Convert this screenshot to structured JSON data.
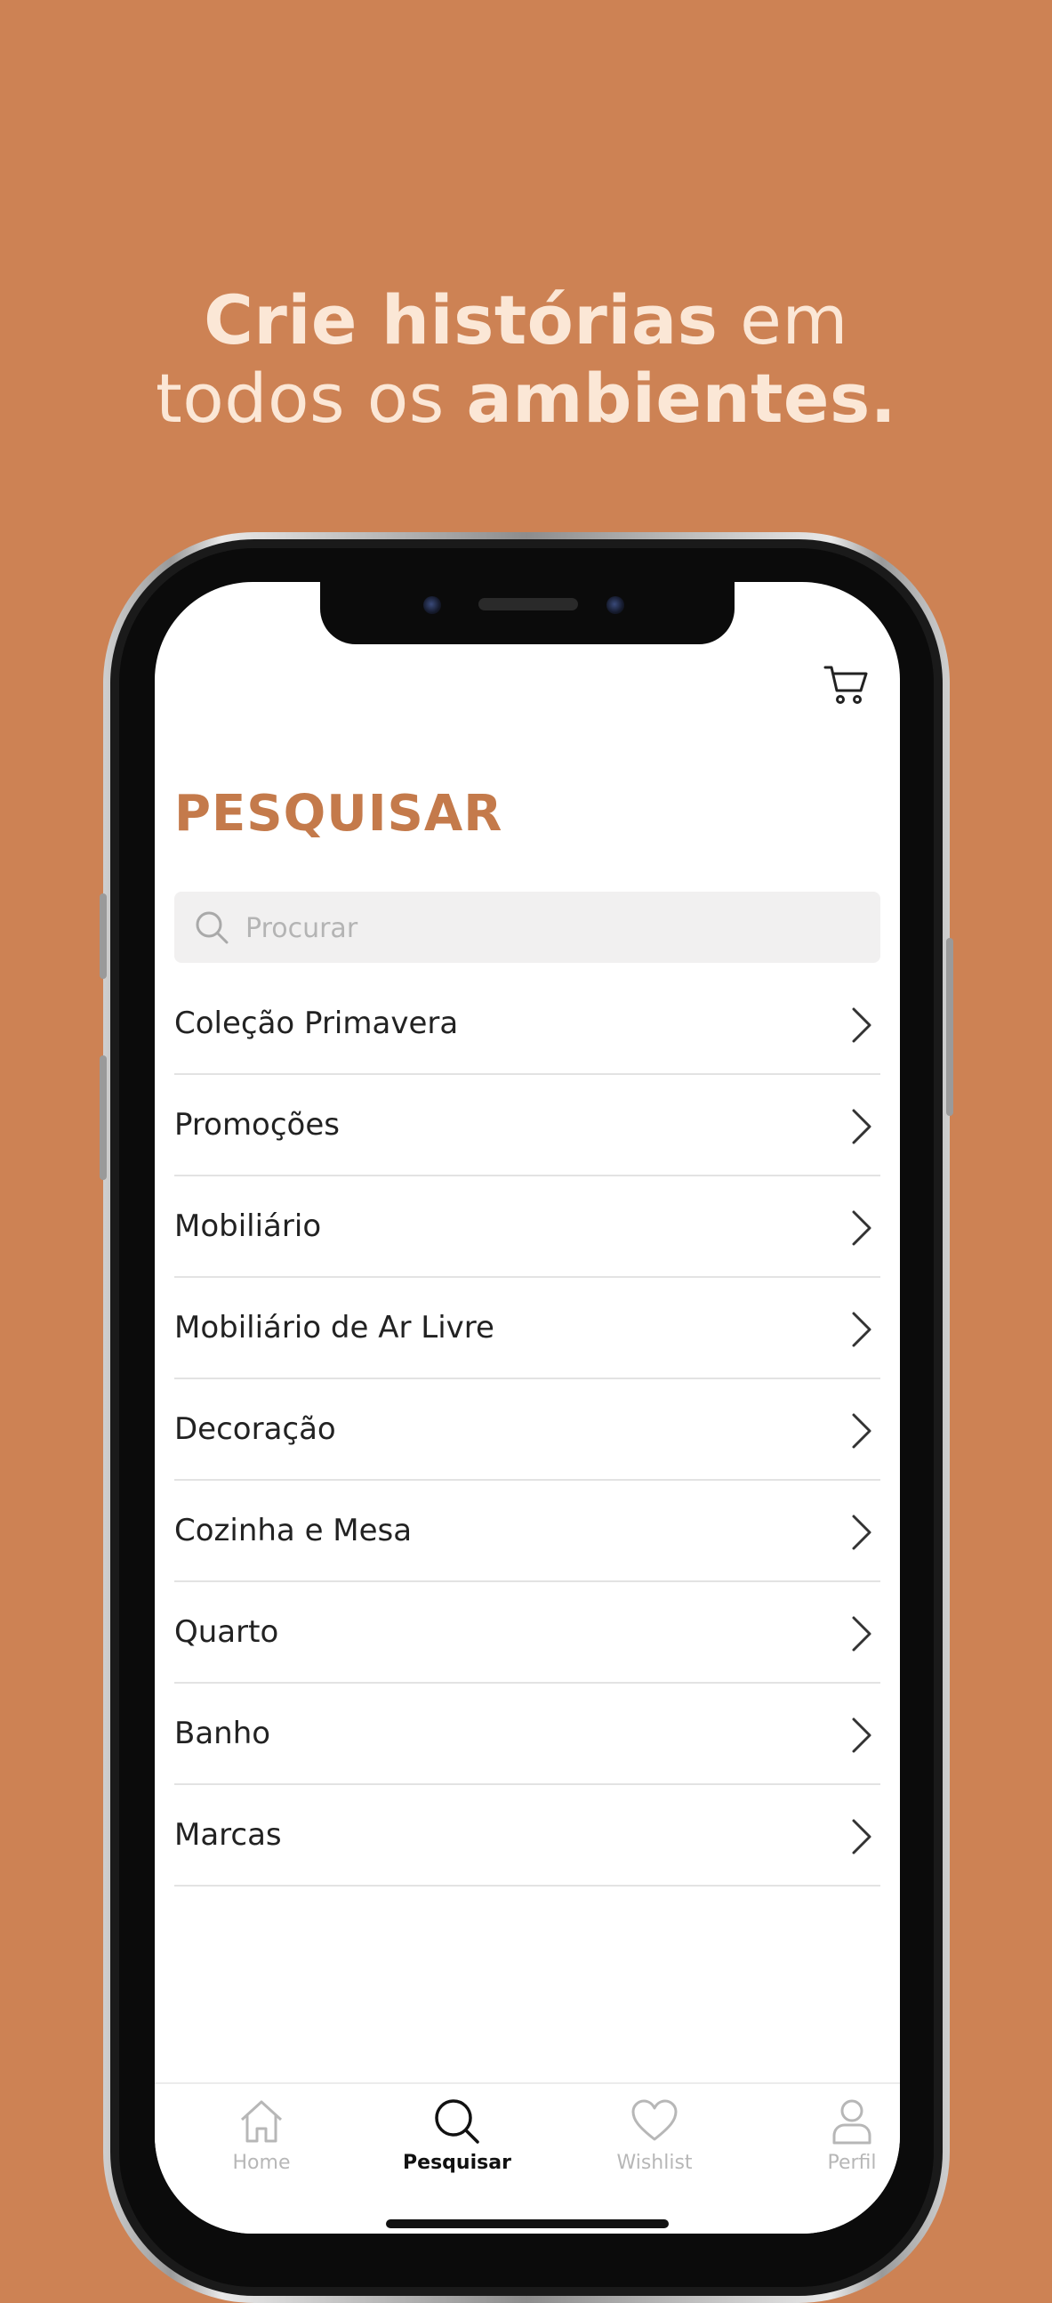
{
  "promo": {
    "line1_bold": "Crie histórias",
    "line1_light": "em",
    "line2_light": "todos os",
    "line2_bold": "ambientes."
  },
  "colors": {
    "background": "#cd8254",
    "accent": "#c47a4b",
    "headline": "#fbe7d6"
  },
  "header": {
    "cart_icon": "cart-icon",
    "title": "PESQUISAR"
  },
  "search": {
    "placeholder": "Procurar",
    "value": ""
  },
  "categories": [
    {
      "label": "Coleção Primavera"
    },
    {
      "label": "Promoções"
    },
    {
      "label": "Mobiliário"
    },
    {
      "label": "Mobiliário de Ar Livre"
    },
    {
      "label": "Decoração"
    },
    {
      "label": "Cozinha e Mesa"
    },
    {
      "label": "Quarto"
    },
    {
      "label": "Banho"
    },
    {
      "label": "Marcas"
    }
  ],
  "tabbar": {
    "tabs": [
      {
        "label": "Home",
        "icon": "home-icon",
        "active": false
      },
      {
        "label": "Pesquisar",
        "icon": "search-icon",
        "active": true
      },
      {
        "label": "Wishlist",
        "icon": "heart-icon",
        "active": false
      },
      {
        "label": "Perfil",
        "icon": "user-icon",
        "active": false
      }
    ]
  }
}
